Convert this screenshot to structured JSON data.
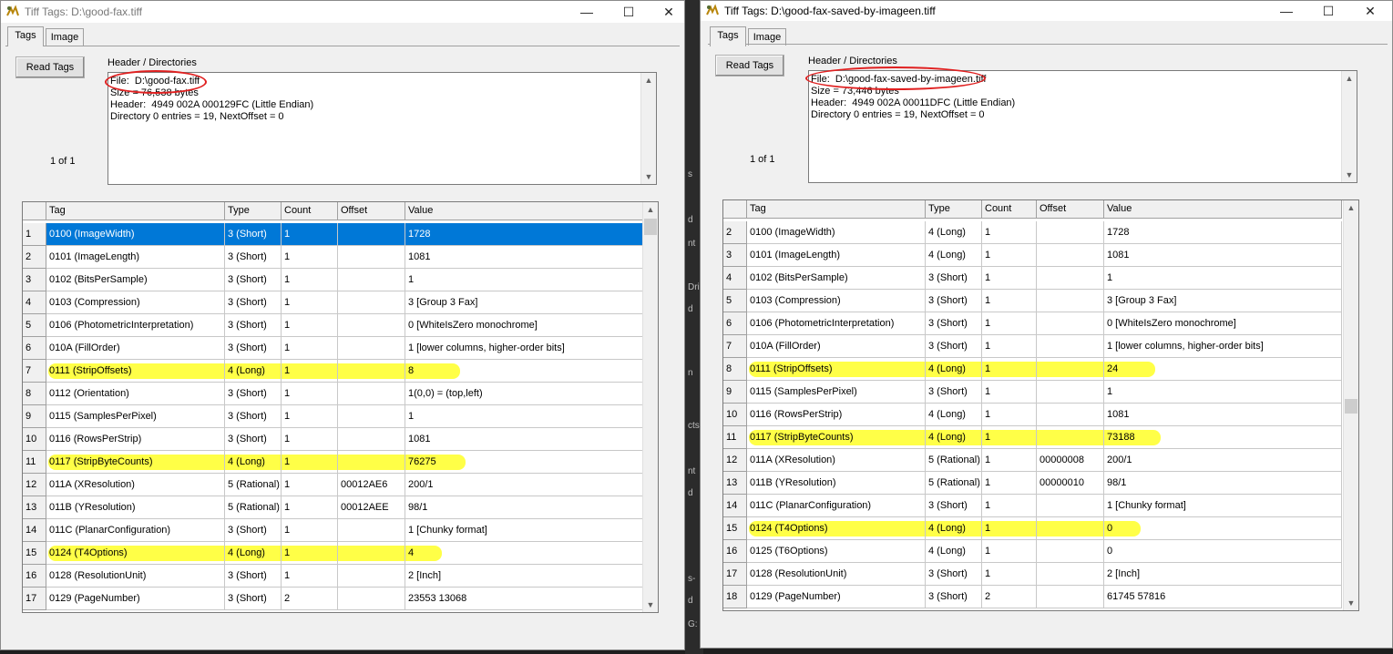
{
  "left": {
    "title": "Tiff Tags:  D:\\good-fax.tiff",
    "tabs": [
      "Tags",
      "Image"
    ],
    "read_tags_label": "Read Tags",
    "header_label": "Header / Directories",
    "header_lines": [
      "File:  D:\\good-fax.tiff",
      "Size = 76,538 bytes",
      "Header:  4949 002A 000129FC (Little Endian)",
      "Directory 0 entries = 19, NextOffset = 0"
    ],
    "pager": "1    of 1",
    "columns": [
      "Tag",
      "Type",
      "Count",
      "Offset",
      "Value"
    ],
    "rows": [
      {
        "n": "1",
        "tag": "0100 (ImageWidth)",
        "type": "3 (Short)",
        "count": "1",
        "offset": "",
        "value": "1728"
      },
      {
        "n": "2",
        "tag": "0101 (ImageLength)",
        "type": "3 (Short)",
        "count": "1",
        "offset": "",
        "value": "1081"
      },
      {
        "n": "3",
        "tag": "0102 (BitsPerSample)",
        "type": "3 (Short)",
        "count": "1",
        "offset": "",
        "value": "1"
      },
      {
        "n": "4",
        "tag": "0103 (Compression)",
        "type": "3 (Short)",
        "count": "1",
        "offset": "",
        "value": "3 [Group 3 Fax]"
      },
      {
        "n": "5",
        "tag": "0106 (PhotometricInterpretation)",
        "type": "3 (Short)",
        "count": "1",
        "offset": "",
        "value": "0 [WhiteIsZero monochrome]"
      },
      {
        "n": "6",
        "tag": "010A (FillOrder)",
        "type": "3 (Short)",
        "count": "1",
        "offset": "",
        "value": "1 [lower columns, higher-order bits]"
      },
      {
        "n": "7",
        "tag": "0111 (StripOffsets)",
        "type": "4 (Long)",
        "count": "1",
        "offset": "",
        "value": "8"
      },
      {
        "n": "8",
        "tag": "0112 (Orientation)",
        "type": "3 (Short)",
        "count": "1",
        "offset": "",
        "value": "1(0,0) = (top,left)"
      },
      {
        "n": "9",
        "tag": "0115 (SamplesPerPixel)",
        "type": "3 (Short)",
        "count": "1",
        "offset": "",
        "value": "1"
      },
      {
        "n": "10",
        "tag": "0116 (RowsPerStrip)",
        "type": "3 (Short)",
        "count": "1",
        "offset": "",
        "value": "1081"
      },
      {
        "n": "11",
        "tag": "0117 (StripByteCounts)",
        "type": "4 (Long)",
        "count": "1",
        "offset": "",
        "value": "76275"
      },
      {
        "n": "12",
        "tag": "011A (XResolution)",
        "type": "5 (Rational)",
        "count": "1",
        "offset": "00012AE6",
        "value": "200/1"
      },
      {
        "n": "13",
        "tag": "011B (YResolution)",
        "type": "5 (Rational)",
        "count": "1",
        "offset": "00012AEE",
        "value": "98/1"
      },
      {
        "n": "14",
        "tag": "011C (PlanarConfiguration)",
        "type": "3 (Short)",
        "count": "1",
        "offset": "",
        "value": "1 [Chunky format]"
      },
      {
        "n": "15",
        "tag": "0124 (T4Options)",
        "type": "4 (Long)",
        "count": "1",
        "offset": "",
        "value": "4"
      },
      {
        "n": "16",
        "tag": "0128 (ResolutionUnit)",
        "type": "3 (Short)",
        "count": "1",
        "offset": "",
        "value": "2 [Inch]"
      },
      {
        "n": "17",
        "tag": "0129 (PageNumber)",
        "type": "3 (Short)",
        "count": "2",
        "offset": "",
        "value": "23553 13068"
      }
    ],
    "selected_row": "1",
    "highlighted_rows": [
      "7",
      "11",
      "15"
    ]
  },
  "right": {
    "title": "Tiff Tags:  D:\\good-fax-saved-by-imageen.tiff",
    "tabs": [
      "Tags",
      "Image"
    ],
    "read_tags_label": "Read Tags",
    "header_label": "Header / Directories",
    "header_lines": [
      "File:  D:\\good-fax-saved-by-imageen.tiff",
      "Size = 73,446 bytes",
      "Header:  4949 002A 00011DFC (Little Endian)",
      "Directory 0 entries = 19, NextOffset = 0"
    ],
    "pager": "1    of 1",
    "columns": [
      "Tag",
      "Type",
      "Count",
      "Offset",
      "Value"
    ],
    "rows": [
      {
        "n": "2",
        "tag": "0100 (ImageWidth)",
        "type": "4 (Long)",
        "count": "1",
        "offset": "",
        "value": "1728"
      },
      {
        "n": "3",
        "tag": "0101 (ImageLength)",
        "type": "4 (Long)",
        "count": "1",
        "offset": "",
        "value": "1081"
      },
      {
        "n": "4",
        "tag": "0102 (BitsPerSample)",
        "type": "3 (Short)",
        "count": "1",
        "offset": "",
        "value": "1"
      },
      {
        "n": "5",
        "tag": "0103 (Compression)",
        "type": "3 (Short)",
        "count": "1",
        "offset": "",
        "value": "3 [Group 3 Fax]"
      },
      {
        "n": "6",
        "tag": "0106 (PhotometricInterpretation)",
        "type": "3 (Short)",
        "count": "1",
        "offset": "",
        "value": "0 [WhiteIsZero monochrome]"
      },
      {
        "n": "7",
        "tag": "010A (FillOrder)",
        "type": "3 (Short)",
        "count": "1",
        "offset": "",
        "value": "1 [lower columns, higher-order bits]"
      },
      {
        "n": "8",
        "tag": "0111 (StripOffsets)",
        "type": "4 (Long)",
        "count": "1",
        "offset": "",
        "value": "24"
      },
      {
        "n": "9",
        "tag": "0115 (SamplesPerPixel)",
        "type": "3 (Short)",
        "count": "1",
        "offset": "",
        "value": "1"
      },
      {
        "n": "10",
        "tag": "0116 (RowsPerStrip)",
        "type": "4 (Long)",
        "count": "1",
        "offset": "",
        "value": "1081"
      },
      {
        "n": "11",
        "tag": "0117 (StripByteCounts)",
        "type": "4 (Long)",
        "count": "1",
        "offset": "",
        "value": "73188"
      },
      {
        "n": "12",
        "tag": "011A (XResolution)",
        "type": "5 (Rational)",
        "count": "1",
        "offset": "00000008",
        "value": "200/1"
      },
      {
        "n": "13",
        "tag": "011B (YResolution)",
        "type": "5 (Rational)",
        "count": "1",
        "offset": "00000010",
        "value": "98/1"
      },
      {
        "n": "14",
        "tag": "011C (PlanarConfiguration)",
        "type": "3 (Short)",
        "count": "1",
        "offset": "",
        "value": "1 [Chunky format]"
      },
      {
        "n": "15",
        "tag": "0124 (T4Options)",
        "type": "4 (Long)",
        "count": "1",
        "offset": "",
        "value": "0"
      },
      {
        "n": "16",
        "tag": "0125 (T6Options)",
        "type": "4 (Long)",
        "count": "1",
        "offset": "",
        "value": "0"
      },
      {
        "n": "17",
        "tag": "0128 (ResolutionUnit)",
        "type": "3 (Short)",
        "count": "1",
        "offset": "",
        "value": "2 [Inch]"
      },
      {
        "n": "18",
        "tag": "0129 (PageNumber)",
        "type": "3 (Short)",
        "count": "2",
        "offset": "",
        "value": "61745 57816"
      }
    ],
    "selected_row": "",
    "highlighted_rows": [
      "8",
      "11",
      "15"
    ]
  },
  "background_glyphs": [
    "s",
    "d",
    "nt",
    "Dri",
    "d",
    "n",
    "cts",
    "nt",
    "d",
    "s-",
    "d",
    "G:"
  ],
  "colors": {
    "selection": "#0078d7",
    "highlight": "#ffff33",
    "annotation_circle": "#e02020"
  }
}
